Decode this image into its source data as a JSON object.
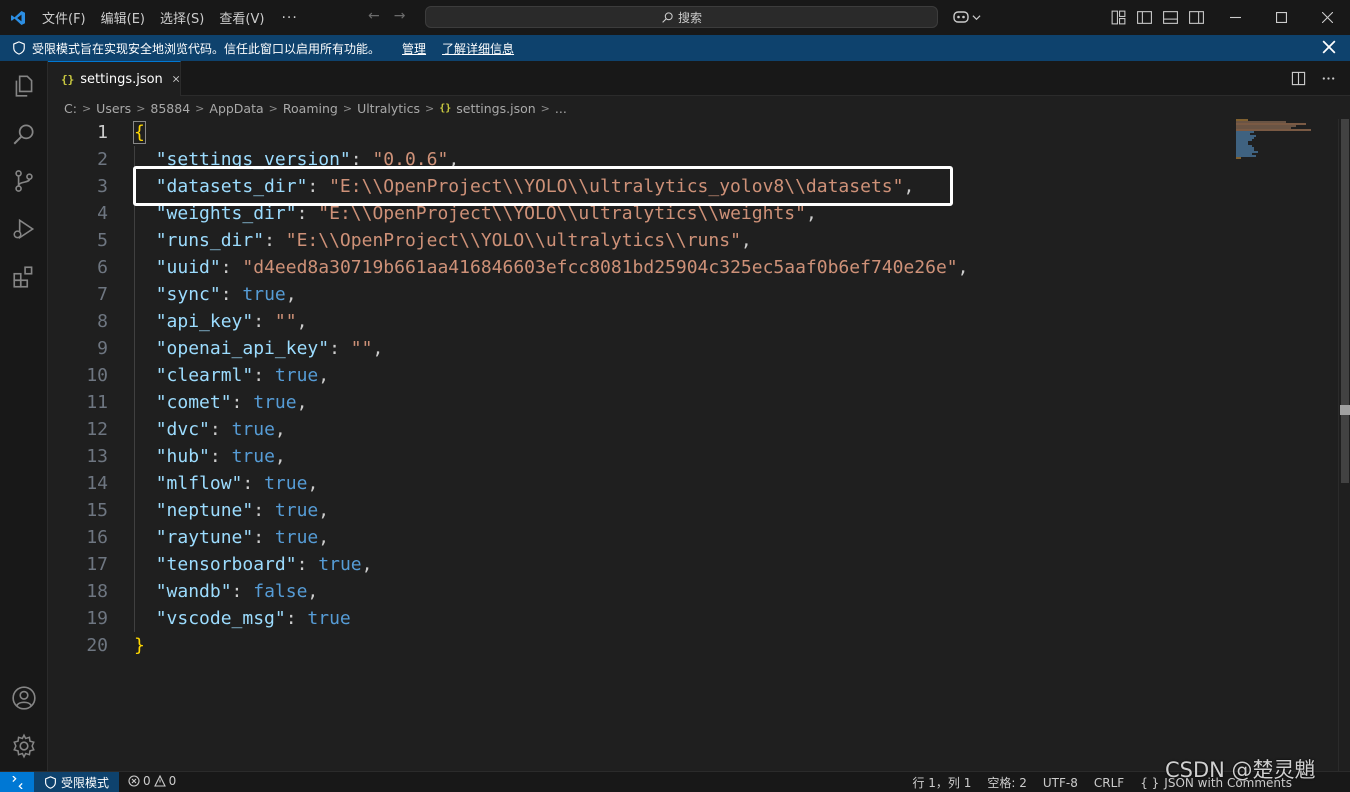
{
  "titlebar": {
    "menus": [
      "文件(F)",
      "编辑(E)",
      "选择(S)",
      "查看(V)"
    ],
    "more": "···",
    "nav_back": "←",
    "nav_forward": "→",
    "search_placeholder": "搜索"
  },
  "banner": {
    "message": "受限模式旨在实现安全地浏览代码。信任此窗口以启用所有功能。",
    "manage_link": "管理",
    "learn_more_link": "了解详细信息"
  },
  "tab": {
    "label": "settings.json",
    "icon_text": "{}"
  },
  "breadcrumb": [
    "C:",
    "Users",
    "85884",
    "AppData",
    "Roaming",
    "Ultralytics",
    "settings.json",
    "..."
  ],
  "editor": {
    "lines": [
      {
        "n": "1",
        "key": "",
        "value": "",
        "prefix": "{",
        "suffix": ""
      },
      {
        "n": "2",
        "key": "\"settings_version\"",
        "value": "\"0.0.6\"",
        "suffix": ","
      },
      {
        "n": "3",
        "key": "\"datasets_dir\"",
        "value": "\"E:\\\\OpenProject\\\\YOLO\\\\ultralytics_yolov8\\\\datasets\"",
        "suffix": ","
      },
      {
        "n": "4",
        "key": "\"weights_dir\"",
        "value": "\"E:\\\\OpenProject\\\\YOLO\\\\ultralytics\\\\weights\"",
        "suffix": ","
      },
      {
        "n": "5",
        "key": "\"runs_dir\"",
        "value": "\"E:\\\\OpenProject\\\\YOLO\\\\ultralytics\\\\runs\"",
        "suffix": ","
      },
      {
        "n": "6",
        "key": "\"uuid\"",
        "value": "\"d4eed8a30719b661aa416846603efcc8081bd25904c325ec5aaf0b6ef740e26e\"",
        "suffix": ","
      },
      {
        "n": "7",
        "key": "\"sync\"",
        "value": "true",
        "suffix": ","
      },
      {
        "n": "8",
        "key": "\"api_key\"",
        "value": "\"\"",
        "suffix": ","
      },
      {
        "n": "9",
        "key": "\"openai_api_key\"",
        "value": "\"\"",
        "suffix": ","
      },
      {
        "n": "10",
        "key": "\"clearml\"",
        "value": "true",
        "suffix": ","
      },
      {
        "n": "11",
        "key": "\"comet\"",
        "value": "true",
        "suffix": ","
      },
      {
        "n": "12",
        "key": "\"dvc\"",
        "value": "true",
        "suffix": ","
      },
      {
        "n": "13",
        "key": "\"hub\"",
        "value": "true",
        "suffix": ","
      },
      {
        "n": "14",
        "key": "\"mlflow\"",
        "value": "true",
        "suffix": ","
      },
      {
        "n": "15",
        "key": "\"neptune\"",
        "value": "true",
        "suffix": ","
      },
      {
        "n": "16",
        "key": "\"raytune\"",
        "value": "true",
        "suffix": ","
      },
      {
        "n": "17",
        "key": "\"tensorboard\"",
        "value": "true",
        "suffix": ","
      },
      {
        "n": "18",
        "key": "\"wandb\"",
        "value": "false",
        "suffix": ","
      },
      {
        "n": "19",
        "key": "\"vscode_msg\"",
        "value": "true",
        "suffix": ""
      },
      {
        "n": "20",
        "key": "",
        "value": "",
        "prefix": "}",
        "suffix": ""
      }
    ]
  },
  "statusbar": {
    "restricted_label": "受限模式",
    "errors": "0",
    "warnings": "0",
    "cursor_position": "行 1，列 1",
    "indentation": "空格: 2",
    "encoding": "UTF-8",
    "eol": "CRLF",
    "language_icon": "{ }",
    "language": "JSON with Comments"
  },
  "watermark": "CSDN @楚灵魈",
  "colors": {
    "accent": "#0078d4",
    "banner": "#0e426d",
    "json_key": "#9cdcfe",
    "json_string": "#ce9178",
    "json_bool": "#569cd6",
    "bracket": "#ffd700"
  }
}
